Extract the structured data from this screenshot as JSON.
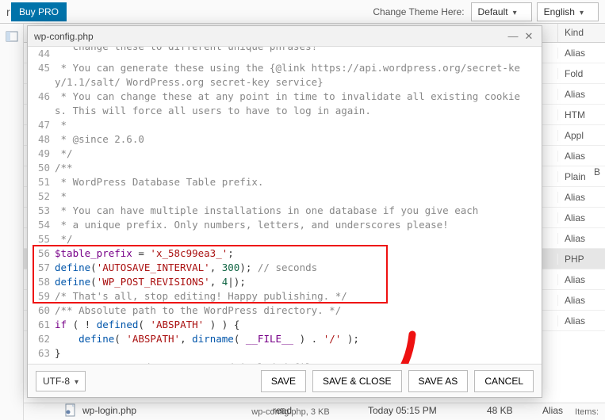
{
  "topbar": {
    "left_char": "r",
    "buy_pro": "Buy PRO",
    "change_theme_label": "Change Theme Here:",
    "theme_value": "Default",
    "lang_value": "English"
  },
  "dialog": {
    "title": "wp-config.php",
    "encoding": "UTF-8",
    "buttons": {
      "save": "SAVE",
      "save_close": "SAVE & CLOSE",
      "save_as": "SAVE AS",
      "cancel": "CANCEL"
    }
  },
  "code": {
    "lines": [
      {
        "n": 44,
        "raw": "   change these to different unique phrases!",
        "cls": "comment",
        "truncated_top": true
      },
      {
        "n": 45,
        "raw": " * You can generate these using the {@link https://api.wordpress.org/secret-key/1.1/salt/ WordPress.org secret-key service}",
        "cls": "comment"
      },
      {
        "n": 46,
        "raw": " * You can change these at any point in time to invalidate all existing cookies. This will force all users to have to log in again.",
        "cls": "comment"
      },
      {
        "n": 47,
        "raw": " *",
        "cls": "comment"
      },
      {
        "n": 48,
        "raw": " * @since 2.6.0",
        "cls": "comment"
      },
      {
        "n": 49,
        "raw": " */",
        "cls": "comment"
      },
      {
        "n": 50,
        "raw": "/**",
        "cls": "comment"
      },
      {
        "n": 51,
        "raw": " * WordPress Database Table prefix.",
        "cls": "comment"
      },
      {
        "n": 52,
        "raw": " *",
        "cls": "comment"
      },
      {
        "n": 53,
        "raw": " * You can have multiple installations in one database if you give each",
        "cls": "comment"
      },
      {
        "n": 54,
        "raw": " * a unique prefix. Only numbers, letters, and underscores please!",
        "cls": "comment"
      },
      {
        "n": 55,
        "raw": " */",
        "cls": "comment"
      },
      {
        "n": 56,
        "tokens": [
          [
            "$table_prefix",
            "keyword"
          ],
          [
            " = ",
            ""
          ],
          [
            "'x_58c99ea3_'",
            "string"
          ],
          [
            ";",
            ""
          ]
        ]
      },
      {
        "n": 57,
        "tokens": [
          [
            "define",
            "func"
          ],
          [
            "(",
            ""
          ],
          [
            "'AUTOSAVE_INTERVAL'",
            "string"
          ],
          [
            ", ",
            ""
          ],
          [
            "300",
            "number"
          ],
          [
            "); ",
            ""
          ],
          [
            "// seconds",
            "comment"
          ]
        ]
      },
      {
        "n": 58,
        "tokens": [
          [
            "define",
            "func"
          ],
          [
            "(",
            ""
          ],
          [
            "'WP_POST_REVISIONS'",
            "string"
          ],
          [
            ", ",
            ""
          ],
          [
            "4",
            "number"
          ],
          [
            "|);",
            ""
          ]
        ]
      },
      {
        "n": 59,
        "raw": "/* That's all, stop editing! Happy publishing. */",
        "cls": "comment"
      },
      {
        "n": 60,
        "raw": "/** Absolute path to the WordPress directory. */",
        "cls": "comment"
      },
      {
        "n": 61,
        "tokens": [
          [
            "if",
            "keyword"
          ],
          [
            " ( ! ",
            ""
          ],
          [
            "defined",
            "func"
          ],
          [
            "( ",
            ""
          ],
          [
            "'ABSPATH'",
            "string"
          ],
          [
            " ) ) {",
            ""
          ]
        ]
      },
      {
        "n": 62,
        "tokens": [
          [
            "    define",
            "func"
          ],
          [
            "( ",
            ""
          ],
          [
            "'ABSPATH'",
            "string"
          ],
          [
            ", ",
            ""
          ],
          [
            "dirname",
            "func"
          ],
          [
            "( ",
            ""
          ],
          [
            "__FILE__",
            "keyword"
          ],
          [
            " ) . ",
            ""
          ],
          [
            "'/'",
            "string"
          ],
          [
            " );",
            ""
          ]
        ]
      },
      {
        "n": 63,
        "raw": "}",
        "cls": ""
      },
      {
        "n": 64,
        "raw": "/** Sets up WordPress vars and included files. */",
        "cls": "comment"
      }
    ]
  },
  "filelist": {
    "head_kind": "Kind",
    "kinds": [
      "Alias",
      "Fold",
      "Alias",
      "HTM",
      "Appl",
      "Alias",
      "Plain",
      "Alias",
      "Alias",
      "Alias",
      "PHP",
      "Alias",
      "Alias",
      "Alias"
    ],
    "sel_index": 10,
    "visible_row": {
      "name": "wp-login.php",
      "perm": "read",
      "date": "Today 05:15 PM",
      "size": "48 KB",
      "kind": "Alias"
    },
    "status_name": "wp-config.php, 3 KB",
    "status_items": "Items:"
  },
  "side_b_char": "B"
}
